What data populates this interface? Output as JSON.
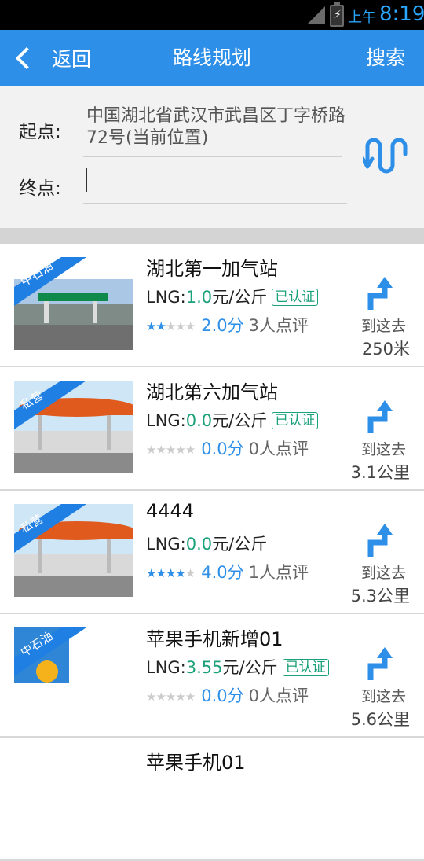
{
  "status_bar": {
    "ampm": "上午",
    "time": "8:19"
  },
  "header": {
    "back_label": "返回",
    "title": "路线规划",
    "search_label": "搜索"
  },
  "route": {
    "from_label": "起点:",
    "from_value": "中国湖北省武汉市武昌区丁字桥路72号(当前位置)",
    "to_label": "终点:",
    "to_value": ""
  },
  "stations": [
    {
      "tag": "中石油",
      "name": "湖北第一加气站",
      "fuel": "LNG:",
      "price": "1.0",
      "unit": "元/公斤",
      "badge": "已认证",
      "stars_filled": 2,
      "score": "2.0分",
      "reviews": "3人点评",
      "nav_label": "到这去",
      "distance": "250米"
    },
    {
      "tag": "私营",
      "name": "湖北第六加气站",
      "fuel": "LNG:",
      "price": "0.0",
      "unit": "元/公斤",
      "badge": "已认证",
      "stars_filled": 0,
      "score": "0.0分",
      "reviews": "0人点评",
      "nav_label": "到这去",
      "distance": "3.1公里"
    },
    {
      "tag": "私营",
      "name": "4444",
      "fuel": "LNG:",
      "price": "0.0",
      "unit": "元/公斤",
      "badge": "",
      "stars_filled": 4,
      "score": "4.0分",
      "reviews": "1人点评",
      "nav_label": "到这去",
      "distance": "5.3公里"
    },
    {
      "tag": "中石油",
      "name": "苹果手机新增01",
      "fuel": "LNG:",
      "price": "3.55",
      "unit": "元/公斤",
      "badge": "已认证",
      "stars_filled": 0,
      "score": "0.0分",
      "reviews": "0人点评",
      "nav_label": "到这去",
      "distance": "5.6公里"
    },
    {
      "tag": "",
      "name": "苹果手机01",
      "fuel": "",
      "price": "",
      "unit": "",
      "badge": "",
      "stars_filled": 0,
      "score": "",
      "reviews": "",
      "nav_label": "",
      "distance": ""
    }
  ],
  "colors": {
    "primary": "#2e8fe8",
    "price": "#1aa07a",
    "star_on": "#2e8fe8",
    "star_off": "#cccccc"
  }
}
